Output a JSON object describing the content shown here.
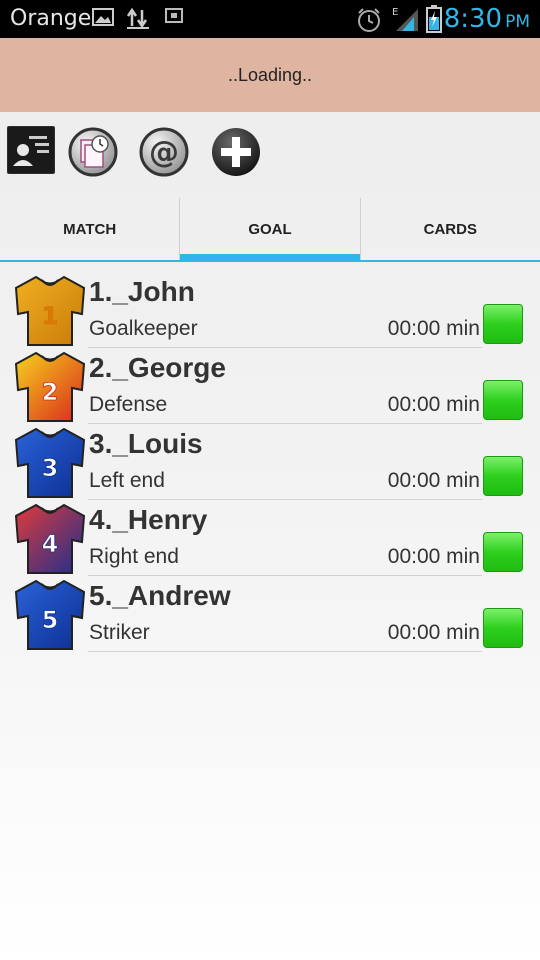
{
  "status_bar": {
    "carrier": "Orange",
    "time": "8:30",
    "ampm": "PM",
    "icons": [
      "image-icon",
      "sync-arrows-icon",
      "screenshot-icon",
      "alarm-icon",
      "signal-icon",
      "battery-icon"
    ]
  },
  "banner": {
    "text": "..Loading.."
  },
  "toolbar": {
    "buttons": [
      "contact-card-icon",
      "history-clock-icon",
      "email-at-icon",
      "add-plus-icon"
    ]
  },
  "tabs": [
    {
      "label": "MATCH",
      "active": false
    },
    {
      "label": "GOAL",
      "active": true
    },
    {
      "label": "CARDS",
      "active": false
    }
  ],
  "players": [
    {
      "name": "1._John",
      "position": "Goalkeeper",
      "time": "00:00 min",
      "number": "1",
      "colors": [
        "#f0b020",
        "#c97a0a"
      ]
    },
    {
      "name": "2._George",
      "position": "Defense",
      "time": "00:00 min",
      "number": "2",
      "colors": [
        "#f6d21e",
        "#d9261c"
      ]
    },
    {
      "name": "3._Louis",
      "position": "Left end",
      "time": "00:00 min",
      "number": "3",
      "colors": [
        "#2a62d8",
        "#0d2f92"
      ]
    },
    {
      "name": "4._Henry",
      "position": "Right end",
      "time": "00:00 min",
      "number": "4",
      "colors": [
        "#e03a3a",
        "#1c2f8f"
      ]
    },
    {
      "name": "5._Andrew",
      "position": "Striker",
      "time": "00:00 min",
      "number": "5",
      "colors": [
        "#2a62d8",
        "#0d2f92"
      ]
    }
  ],
  "colors": {
    "accent": "#33b5e5",
    "banner": "#dfb4a0",
    "status_green": "#2ed01f"
  }
}
